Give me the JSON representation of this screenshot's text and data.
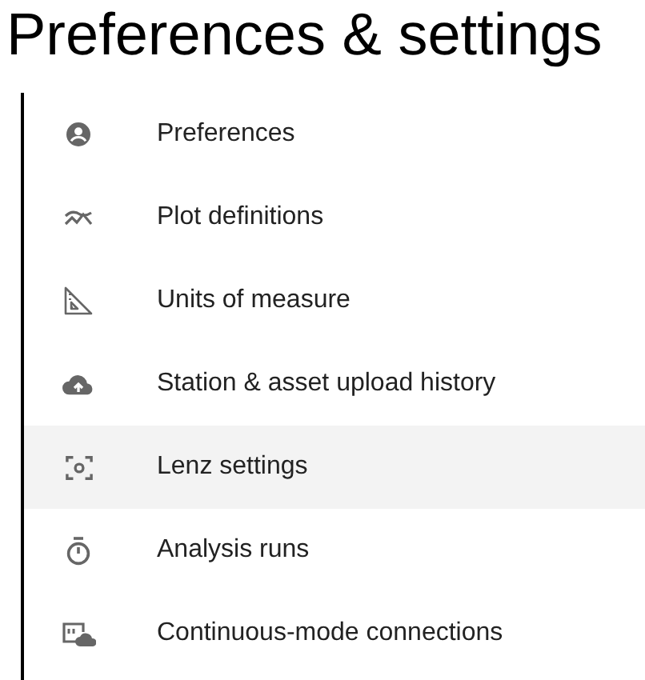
{
  "title": "Preferences & settings",
  "items": [
    {
      "label": "Preferences",
      "selected": false
    },
    {
      "label": "Plot definitions",
      "selected": false
    },
    {
      "label": "Units of measure",
      "selected": false
    },
    {
      "label": "Station & asset upload history",
      "selected": false
    },
    {
      "label": "Lenz settings",
      "selected": true
    },
    {
      "label": "Analysis runs",
      "selected": false
    },
    {
      "label": "Continuous-mode connections",
      "selected": false
    }
  ]
}
